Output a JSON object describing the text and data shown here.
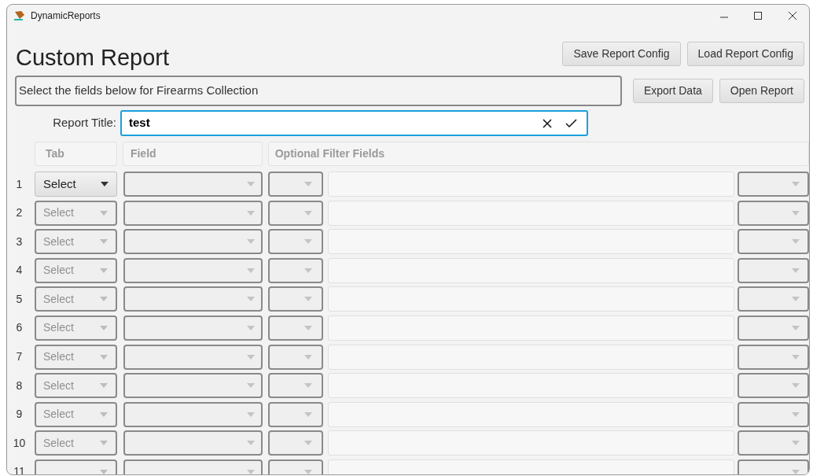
{
  "window": {
    "title": "DynamicReports"
  },
  "heading": "Custom Report",
  "top_buttons": [
    "Save Report Config",
    "Load Report Config"
  ],
  "instructions": "Select the fields below for Firearms Collection",
  "side_buttons": [
    "Export Data",
    "Open Report"
  ],
  "report_title": {
    "label": "Report Title:",
    "value": "test",
    "focused": true
  },
  "columns": [
    "Tab",
    "Field",
    "Optional Filter Fields"
  ],
  "rows": [
    {
      "number": "1",
      "tab": "Select",
      "disabled": false
    },
    {
      "number": "2",
      "tab": "Select",
      "disabled": true
    },
    {
      "number": "3",
      "tab": "Select",
      "disabled": true
    },
    {
      "number": "4",
      "tab": "Select",
      "disabled": true
    },
    {
      "number": "5",
      "tab": "Select",
      "disabled": true
    },
    {
      "number": "6",
      "tab": "Select",
      "disabled": true
    },
    {
      "number": "7",
      "tab": "Select",
      "disabled": true
    },
    {
      "number": "8",
      "tab": "Select",
      "disabled": true
    },
    {
      "number": "9",
      "tab": "Select",
      "disabled": true
    },
    {
      "number": "10",
      "tab": "Select",
      "disabled": true
    },
    {
      "number": "11",
      "disabled": true
    }
  ]
}
